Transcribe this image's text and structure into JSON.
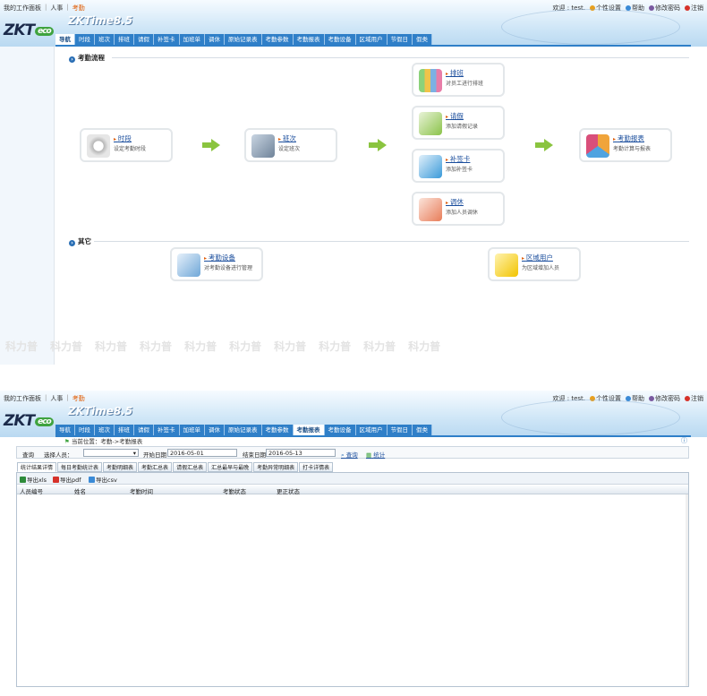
{
  "header": {
    "top_links": [
      "我的工作面板",
      "人事",
      "考勤"
    ],
    "right_links": [
      {
        "label": "欢迎 : test.",
        "color": ""
      },
      {
        "label": "个性设置",
        "color": "#e8a020"
      },
      {
        "label": "帮助",
        "color": "#3a8ad6"
      },
      {
        "label": "修改密码",
        "color": "#7a5aa0"
      },
      {
        "label": "注销",
        "color": "#d6322a"
      }
    ],
    "logo": "ZKT",
    "logo_eco": "eco",
    "product": "ZKTime8.5",
    "nav_tabs": [
      "导航",
      "时段",
      "班次",
      "排班",
      "请假",
      "补签卡",
      "加班单",
      "调休",
      "原始记录表",
      "考勤参数",
      "考勤报表",
      "考勤设备",
      "区域用户",
      "节假日",
      "假类"
    ]
  },
  "screen1": {
    "active_tab": "导航",
    "section_flow": "考勤流程",
    "section_other": "其它",
    "cards": [
      {
        "title": "时段",
        "desc": "设定考勤时段",
        "icon_color": "#c9c9c9",
        "icon": "clock-icon"
      },
      {
        "title": "班次",
        "desc": "设定班次",
        "icon_color": "#7f93a8",
        "icon": "schedule-book-icon"
      },
      {
        "title": "排班",
        "desc": "对员工进行排班",
        "icon_color": "#7cb1e3",
        "icon": "staff-bar-icon"
      },
      {
        "title": "请假",
        "desc": "添加请假记录",
        "icon_color": "#8bc34a",
        "icon": "leave-pen-icon"
      },
      {
        "title": "补签卡",
        "desc": "添加补签卡",
        "icon_color": "#3a9ad9",
        "icon": "card-plus-icon"
      },
      {
        "title": "调休",
        "desc": "添加人员调休",
        "icon_color": "#e87d5a",
        "icon": "rest-note-icon"
      },
      {
        "title": "考勤报表",
        "desc": "考勤计算与报表",
        "icon_color": "#f0a43a",
        "icon": "report-chart-icon"
      },
      {
        "title": "考勤设备",
        "desc": "对考勤设备进行管理",
        "icon_color": "#6fa7d8",
        "icon": "device-icon"
      },
      {
        "title": "区域用户",
        "desc": "为区域增加人员",
        "icon_color": "#f2c400",
        "icon": "area-users-icon"
      }
    ],
    "watermark": "科力普"
  },
  "screen2": {
    "active_tab": "考勤报表",
    "breadcrumb": "当前位置：考勤->考勤报表",
    "filter": {
      "query_label": "查询",
      "select_person_label": "选择人员：",
      "start_label": "开始日期",
      "start_value": "2016-05-01",
      "end_label": "结束日期",
      "end_value": "2016-05-13",
      "search_btn": "查询",
      "stats_btn": "统计"
    },
    "report_tabs": [
      "统计结果详情",
      "每日考勤统计表",
      "考勤明细表",
      "考勤汇总表",
      "请假汇总表",
      "汇总最早与最晚",
      "考勤异常明细表",
      "打卡详情表"
    ],
    "export": [
      "导出xls",
      "导出pdf",
      "导出csv"
    ],
    "columns": [
      "人员编号",
      "姓名",
      "考勤时间",
      "考勤状态",
      "更正状态"
    ]
  }
}
